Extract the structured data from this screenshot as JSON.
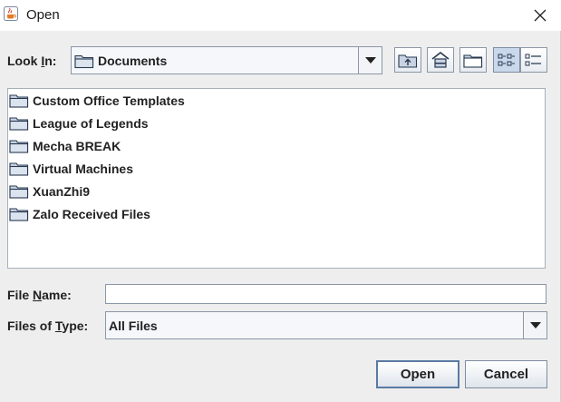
{
  "window": {
    "title": "Open",
    "app_icon": "java-cup-icon",
    "close_icon": "close-icon"
  },
  "look_in": {
    "label_pre": "Look ",
    "label_u": "I",
    "label_post": "n:",
    "value": "Documents",
    "value_icon": "folder-icon"
  },
  "toolbar": {
    "buttons": [
      {
        "name": "up-one-level",
        "icon": "folder-up-icon"
      },
      {
        "name": "home",
        "icon": "home-icon"
      },
      {
        "name": "create-new-folder",
        "icon": "new-folder-icon"
      },
      {
        "name": "list-view",
        "icon": "list-view-icon",
        "pressed": true
      },
      {
        "name": "details-view",
        "icon": "details-view-icon",
        "pressed": false
      }
    ]
  },
  "files": [
    {
      "name": "Custom Office Templates",
      "icon": "folder-icon"
    },
    {
      "name": "League of Legends",
      "icon": "folder-icon"
    },
    {
      "name": "Mecha BREAK",
      "icon": "folder-icon"
    },
    {
      "name": "Virtual Machines",
      "icon": "folder-icon"
    },
    {
      "name": "XuanZhi9",
      "icon": "folder-icon"
    },
    {
      "name": "Zalo Received Files",
      "icon": "folder-icon"
    }
  ],
  "file_name": {
    "label_pre": "File ",
    "label_u": "N",
    "label_post": "ame:",
    "value": "",
    "placeholder": ""
  },
  "files_of_type": {
    "label_pre": "Files of ",
    "label_u": "T",
    "label_post": "ype:",
    "value": "All Files"
  },
  "buttons": {
    "open": "Open",
    "cancel": "Cancel"
  },
  "colors": {
    "accent_border": "#5a7aa3",
    "pressed_bg": "#c9d8ea",
    "folder_fill": "#c8d4e3"
  }
}
